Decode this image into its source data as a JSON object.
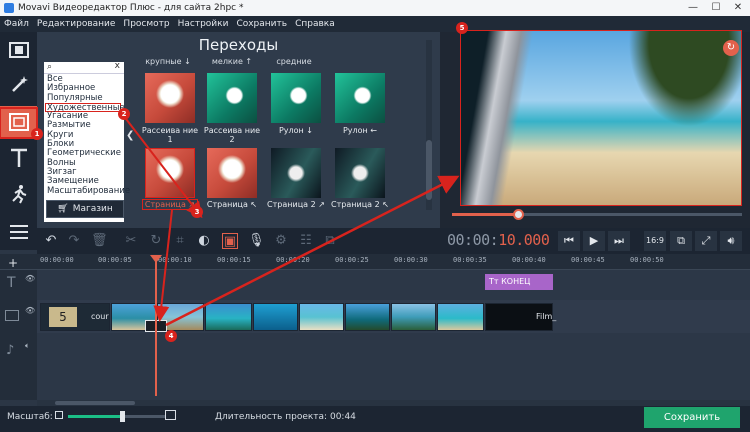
{
  "window": {
    "title": "Movavi Видеоредактор Плюс - для сайта 2hpc *",
    "min": "—",
    "max": "☐",
    "close": "✕"
  },
  "menu": [
    "Файл",
    "Редактирование",
    "Просмотр",
    "Настройки",
    "Сохранить",
    "Справка"
  ],
  "transitions": {
    "title": "Переходы",
    "search_clear": "x",
    "categories": [
      "Все",
      "Избранное",
      "Популярные",
      "Художественные",
      "Угасание",
      "Размытие",
      "Круги",
      "Блоки",
      "Геометрические",
      "Волны",
      "Зигзаг",
      "Замещение",
      "Масштабирование"
    ],
    "selected_category": "Художественные",
    "shop_label": "Магазин",
    "column_heads": [
      "крупные ↓",
      "мелкие ↑",
      "средние"
    ],
    "items": [
      {
        "label": "Рассеива ние 1"
      },
      {
        "label": "Рассеива ние 2"
      },
      {
        "label": "Рулон ↓"
      },
      {
        "label": "Рулон ←"
      },
      {
        "label": "Страница ↗"
      },
      {
        "label": "Страница ↖"
      },
      {
        "label": "Страница 2 ↗"
      },
      {
        "label": "Страница 2 ↖"
      }
    ]
  },
  "player": {
    "timecode_gray": "00:00:",
    "timecode_red": "10.000",
    "aspect": "16:9",
    "progress": 0.22
  },
  "ruler": [
    "00:00:00",
    "00:00:05",
    "00:00:10",
    "00:00:15",
    "00:00:20",
    "00:00:25",
    "00:00:30",
    "00:00:35",
    "00:00:40",
    "00:00:45",
    "00:00:50"
  ],
  "timeline": {
    "title_clip": "КОНЕЦ",
    "title_clip_icon": "Tт",
    "clip_start_label": "cour",
    "clip_end_label": "Film_",
    "intro_number": "5"
  },
  "status": {
    "scale_label": "Масштаб:",
    "duration_label": "Длительность проекта:",
    "duration_value": "00:44",
    "save_label": "Сохранить",
    "zoom": 0.57
  },
  "annotations": [
    "1",
    "2",
    "3",
    "4",
    "5"
  ],
  "colors": {
    "accent": "#e2614c",
    "annotation": "#d8231d",
    "save": "#1fa46d",
    "title_clip": "#a865c9"
  }
}
